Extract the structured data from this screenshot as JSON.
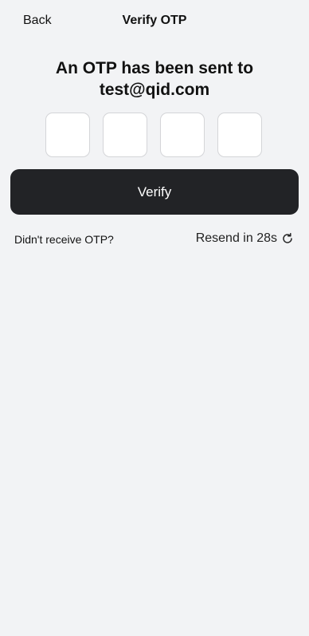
{
  "header": {
    "back_label": "Back",
    "title": "Verify OTP"
  },
  "main": {
    "heading_line1": "An OTP has been sent to",
    "heading_line2": "test@qid.com",
    "otp_fields": [
      {
        "value": ""
      },
      {
        "value": ""
      },
      {
        "value": ""
      },
      {
        "value": ""
      }
    ],
    "verify_label": "Verify",
    "not_received_text": "Didn't receive OTP?",
    "resend_text": "Resend in 28s",
    "resend_icon": "refresh-icon"
  },
  "colors": {
    "background": "#f2f3f5",
    "button": "#222326",
    "button_text": "#ffffff"
  }
}
